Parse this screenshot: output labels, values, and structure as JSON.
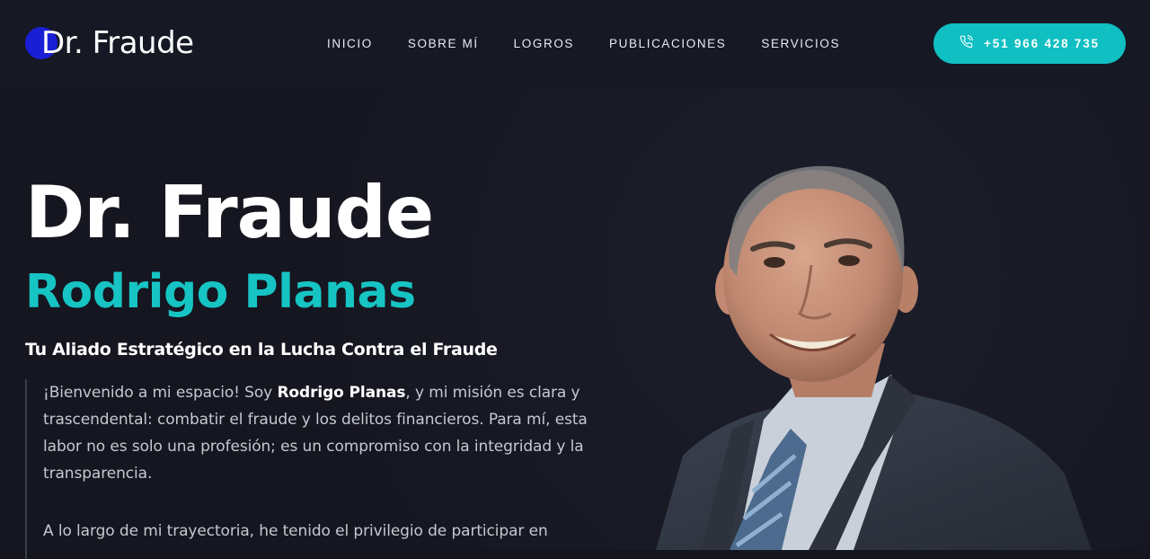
{
  "header": {
    "logo_text": "Dr. Fraude",
    "nav": [
      "INICIO",
      "SOBRE MÍ",
      "LOGROS",
      "PUBLICACIONES",
      "SERVICIOS"
    ],
    "phone": "+51 966 428 735",
    "phone_icon": "phone-icon"
  },
  "hero": {
    "title": "Dr. Fraude",
    "name": "Rodrigo Planas",
    "tagline": "Tu Aliado Estratégico en la Lucha Contra el Fraude",
    "paragraph1_before": "¡Bienvenido a mi espacio! Soy ",
    "paragraph1_bold": "Rodrigo Planas",
    "paragraph1_after": ", y mi misión es clara y trascendental: combatir el fraude y los delitos financieros. Para mí, esta labor no es solo una profesión; es un compromiso con la integridad y la transparencia.",
    "paragraph2": "A lo largo de mi trayectoria, he tenido el privilegio de participar en"
  },
  "colors": {
    "accent": "#17c4c4",
    "button": "#0fbfc2",
    "logo_dot": "#1a1fd6",
    "background": "#151620"
  }
}
